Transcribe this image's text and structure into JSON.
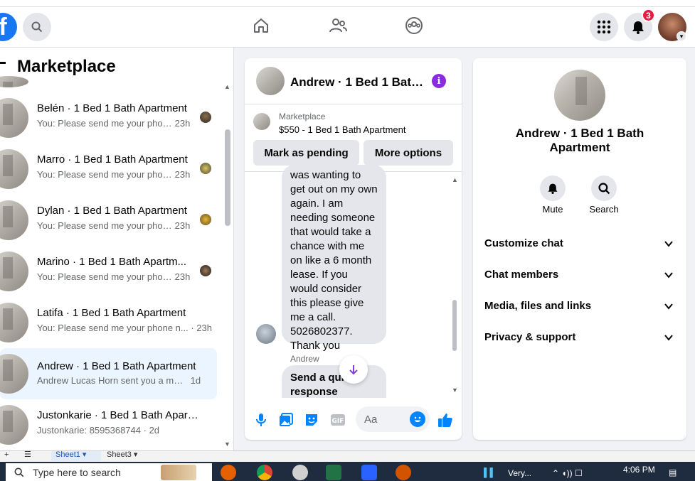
{
  "topnav": {
    "logo": "f",
    "notification_count": "3"
  },
  "left": {
    "title": "Marketplace",
    "conversations": [
      {
        "title": "Belén · 1 Bed 1 Bath Apartment",
        "message": "You: Please send me your phon...",
        "time": "23h"
      },
      {
        "title": "Marro · 1 Bed 1 Bath Apartment",
        "message": "You: Please send me your phon...",
        "time": "23h"
      },
      {
        "title": "Dylan · 1 Bed 1 Bath Apartment",
        "message": "You: Please send me your phon...",
        "time": "23h"
      },
      {
        "title": "Marino · 1 Bed 1 Bath Apartm...",
        "message": "You: Please send me your phon...",
        "time": "23h"
      },
      {
        "title": "Latifa · 1 Bed 1 Bath Apartment",
        "message": "You: Please send me your phone n...",
        "time": "23h"
      },
      {
        "title": "Andrew · 1 Bed 1 Bath Apartment",
        "message": "Andrew Lucas Horn sent you a mes...",
        "time": "1d"
      },
      {
        "title": "Justonkarie · 1 Bed 1 Bath Apart...",
        "message": "Justonkarie: 8595368744",
        "time": "2d"
      }
    ]
  },
  "chat": {
    "header_title": "Andrew · 1 Bed 1 Bath...",
    "listing_label": "Marketplace",
    "listing_title": "$550 - 1 Bed 1 Bath Apartment",
    "mark_pending": "Mark as pending",
    "more_options": "More options",
    "message_text": "was wanting to get out on my own again. I am needing someone that would take a chance with me on like a 6 month lease. If you would consider this please give me a call. 5026802377. Thank you",
    "sender_name": "Andrew",
    "quick_response": "Send a quick response",
    "input_placeholder": "Aa"
  },
  "right": {
    "title": "Andrew · 1 Bed 1 Bath Apartment",
    "mute_label": "Mute",
    "search_label": "Search",
    "sections": [
      "Customize chat",
      "Chat members",
      "Media, files and links",
      "Privacy & support"
    ]
  },
  "sheets": {
    "tab1": "Sheet1",
    "tab2": "Sheet3"
  },
  "taskbar": {
    "search_placeholder": "Type here to search",
    "weather": "Very...",
    "time": "4:06 PM"
  },
  "colors": {
    "brand": "#1877f2",
    "badge": "#e41e3f",
    "messenger_blue": "#0084ff",
    "info_purple": "#8a2be2"
  }
}
